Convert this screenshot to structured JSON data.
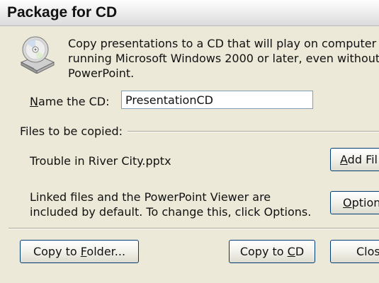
{
  "window": {
    "title": "Package for CD"
  },
  "icon": "cd-package-icon",
  "intro": {
    "line1": "Copy presentations to a CD that will play on computer",
    "line2": "running Microsoft Windows 2000 or later, even without",
    "line3": "PowerPoint."
  },
  "name_cd": {
    "label_prefix": "N",
    "label_rest": "ame the CD:",
    "value": "PresentationCD"
  },
  "files": {
    "section_label": "Files to be copied:",
    "items": [
      "Trouble in River City.pptx"
    ],
    "add_button_prefix": "A",
    "add_button_rest": "dd Fil"
  },
  "linked": {
    "line1": "Linked files and the PowerPoint Viewer are",
    "line2": "included by default. To change this, click Options.",
    "options_button_prefix": "O",
    "options_button_rest": "ption"
  },
  "footer": {
    "copy_folder_prefix": "Copy to ",
    "copy_folder_underlined": "F",
    "copy_folder_rest": "older...",
    "copy_cd_prefix": "Copy to ",
    "copy_cd_underlined": "C",
    "copy_cd_rest": "D",
    "close_label": "Clos"
  }
}
